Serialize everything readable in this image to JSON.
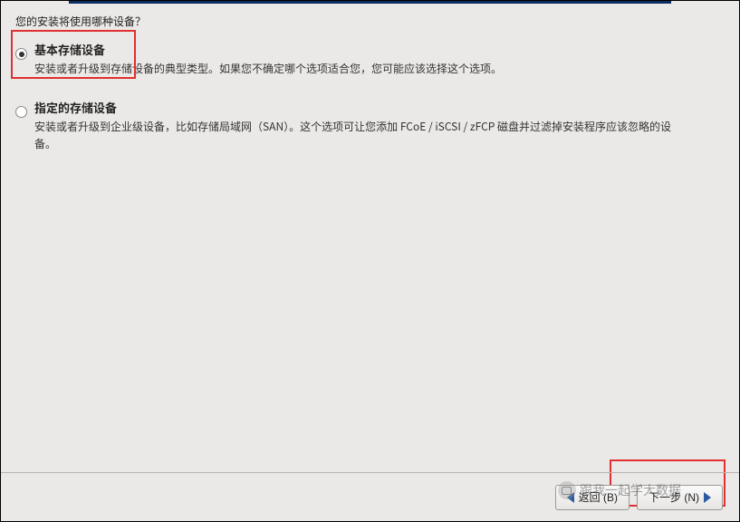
{
  "question": "您的安装将使用哪种设备？",
  "options": [
    {
      "title": "基本存储设备",
      "desc": "安装或者升级到存储设备的典型类型。如果您不确定哪个选项适合您，您可能应该选择这个选项。",
      "checked": true
    },
    {
      "title": "指定的存储设备",
      "desc": "安装或者升级到企业级设备，比如存储局域网（SAN）。这个选项可让您添加 FCoE / iSCSI / zFCP 磁盘并过滤掉安装程序应该忽略的设备。",
      "checked": false
    }
  ],
  "footer": {
    "back_label": "返回 (B)",
    "next_label": "下一步 (N)"
  },
  "watermark": "跟我一起学大数据"
}
